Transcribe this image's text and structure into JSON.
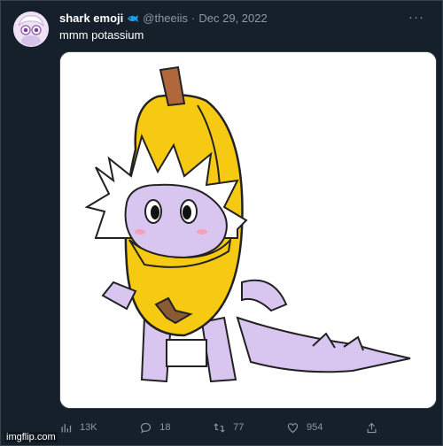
{
  "tweet": {
    "display_name": "shark emoji",
    "verified_icon": "blue-fish-icon",
    "handle": "@theeiis",
    "separator": "·",
    "date": "Dec 29, 2022",
    "text": "mmm potassium",
    "more_icon": "more-icon",
    "more_label": "···"
  },
  "media": {
    "image_icon": "drawing-of-creature-in-banana-costume"
  },
  "actions": {
    "views": {
      "icon": "views-icon",
      "count": "13K"
    },
    "replies": {
      "icon": "reply-icon",
      "count": "18"
    },
    "retweets": {
      "icon": "retweet-icon",
      "count": "77"
    },
    "likes": {
      "icon": "like-icon",
      "count": "954"
    },
    "share": {
      "icon": "share-icon"
    }
  },
  "watermark": {
    "text": "imgflip.com"
  },
  "colors": {
    "background": "#15202b",
    "text_primary": "#ffffff",
    "text_secondary": "#8899a6",
    "verified": "#1d9bf0",
    "banana": "#f6c913",
    "creature": "#d9c6f0"
  }
}
